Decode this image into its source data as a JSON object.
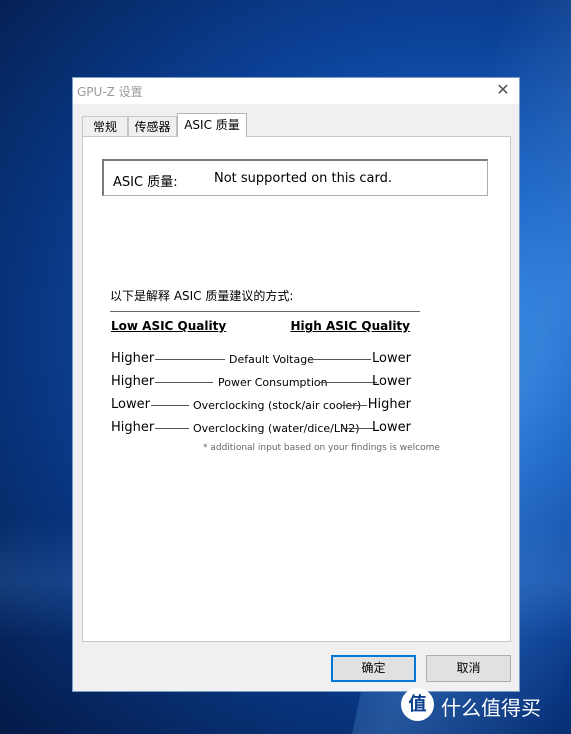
{
  "window": {
    "title": "GPU-Z 设置",
    "close_glyph": "✕"
  },
  "tabs": [
    {
      "label": "常规"
    },
    {
      "label": "传感器"
    },
    {
      "label": "ASIC 质量"
    }
  ],
  "asic": {
    "label": "ASIC 质量:",
    "value": "Not supported on this card."
  },
  "guide": {
    "intro": "以下是解释 ASIC 质量建议的方式:",
    "low_header": "Low ASIC Quality",
    "high_header": "High ASIC Quality",
    "rows": [
      {
        "low": "Higher",
        "metric": "Default Voltage",
        "high": "Lower"
      },
      {
        "low": "Higher",
        "metric": "Power Consumption",
        "high": "Lower"
      },
      {
        "low": "Lower",
        "metric": "Overclocking (stock/air cooler)",
        "high": "Higher"
      },
      {
        "low": "Higher",
        "metric": "Overclocking (water/dice/LN2)",
        "high": "Lower"
      }
    ],
    "note": "* additional input based on your findings is welcome"
  },
  "buttons": {
    "ok": "确定",
    "cancel": "取消"
  },
  "watermark": {
    "glyph": "值",
    "text": "什么值得买"
  }
}
